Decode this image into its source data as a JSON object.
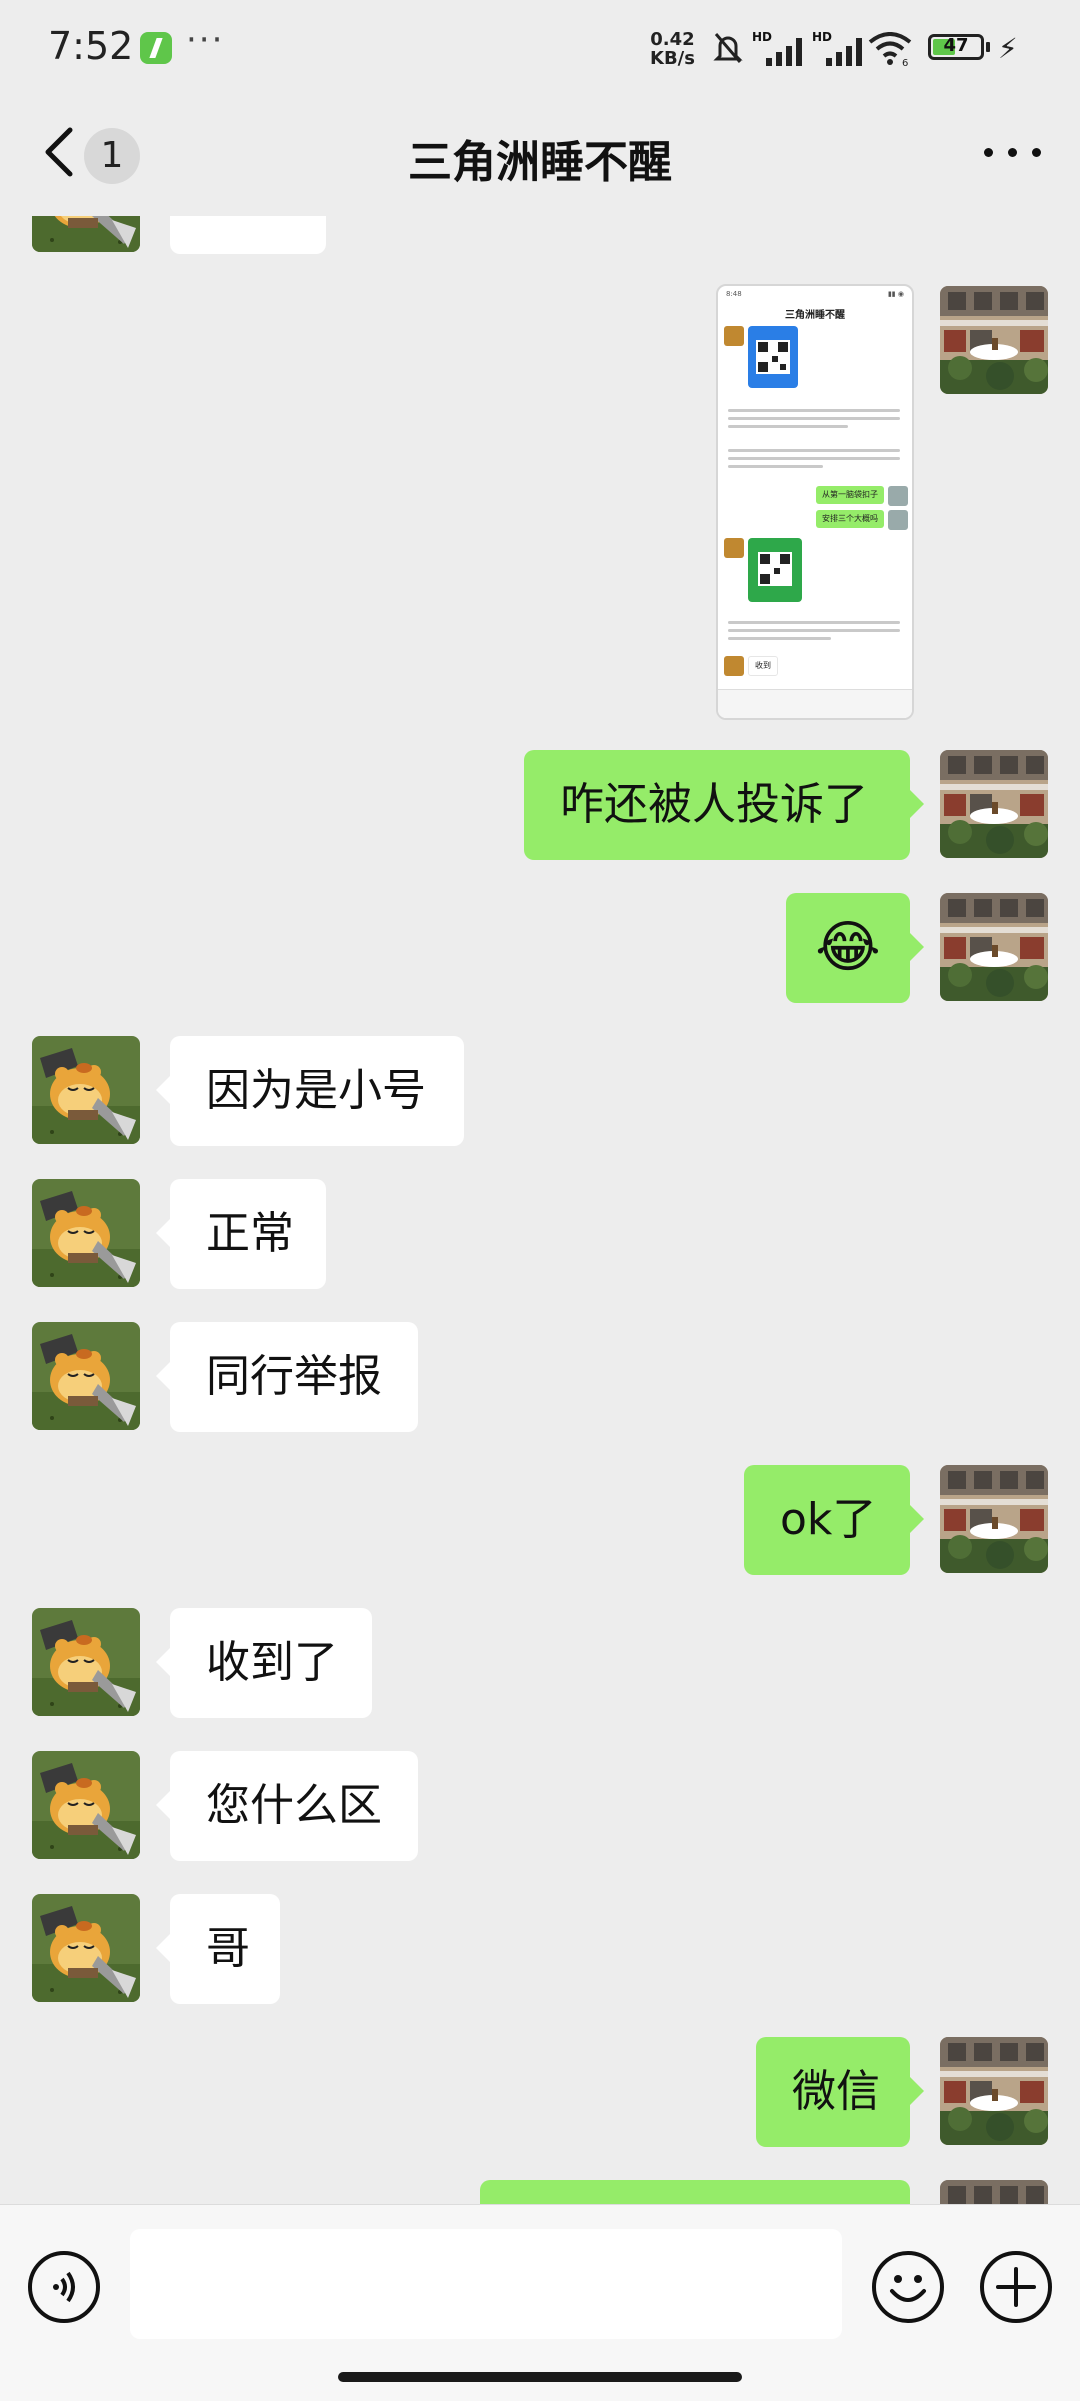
{
  "status_bar": {
    "time": "7:52",
    "dots": "···",
    "net_speed_value": "0.42",
    "net_speed_unit": "KB/s",
    "signal_1_label": "HD",
    "signal_2_label": "HD",
    "wifi_label": "6",
    "battery_level": "47",
    "battery_fraction": 0.47
  },
  "header": {
    "unread_count": "1",
    "title": "三角洲睡不醒"
  },
  "shared_image": {
    "status_time": "8:48",
    "title": "三角洲睡不醒",
    "green_bubble_1": "从第一脑袋扣子",
    "green_bubble_2": "安排三个大概吗",
    "white_bubble": "收到"
  },
  "messages": [
    {
      "side": "in",
      "text": ""
    },
    {
      "side": "out",
      "type": "image"
    },
    {
      "side": "out",
      "text": "咋还被人投诉了"
    },
    {
      "side": "out",
      "text": "😂"
    },
    {
      "side": "in",
      "text": "因为是小号"
    },
    {
      "side": "in",
      "text": "正常"
    },
    {
      "side": "in",
      "text": "同行举报"
    },
    {
      "side": "out",
      "text": "ok了"
    },
    {
      "side": "in",
      "text": "收到了"
    },
    {
      "side": "in",
      "text": "您什么区"
    },
    {
      "side": "in",
      "text": "哥"
    },
    {
      "side": "out",
      "text": "微信"
    },
    {
      "side": "out",
      "text": ""
    }
  ],
  "input_bar": {
    "placeholder": "",
    "icons": [
      "voice-icon",
      "emoji-icon",
      "plus-icon"
    ]
  },
  "colors": {
    "background": "#ededed",
    "bubble_out": "#95ec69",
    "bubble_in": "#ffffff",
    "accent_green": "#5fc64a"
  }
}
